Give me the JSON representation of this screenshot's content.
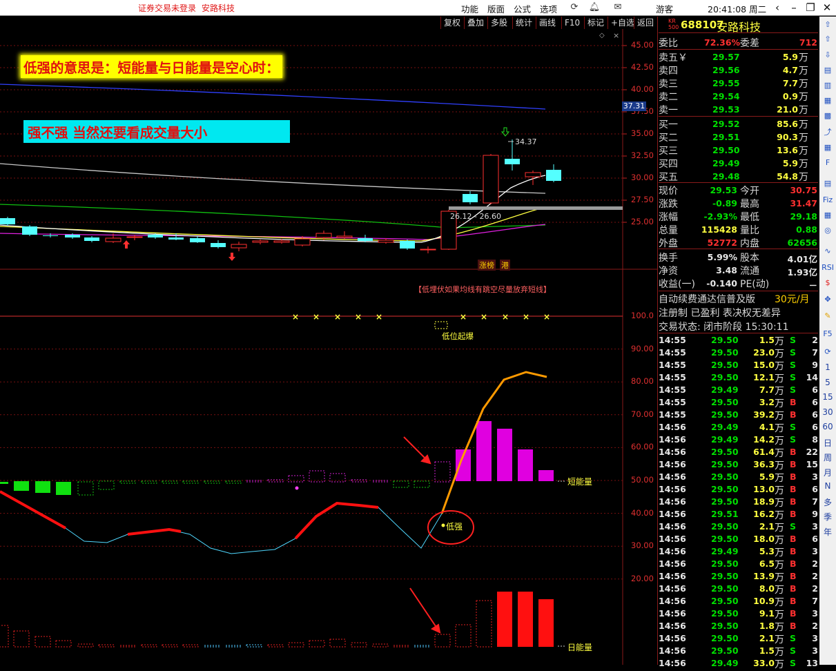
{
  "titlebar": {
    "login_status": "证券交易未登录",
    "stock_name": "安路科技",
    "menus": [
      "功能",
      "版面",
      "公式",
      "选项"
    ],
    "user": "游客",
    "clock": "20:41:08 周二"
  },
  "chart_toolbar": [
    "复权",
    "叠加",
    "多股",
    "统计",
    "画线",
    "F10",
    "标记",
    "+自选",
    "返回"
  ],
  "price_axis": [
    "45.00",
    "42.50",
    "40.00",
    "37.50",
    "35.00",
    "32.50",
    "30.00",
    "27.50",
    "25.00"
  ],
  "price_marker": "37.31",
  "indicator_axis": [
    "100.0",
    "90.00",
    "80.00",
    "70.00",
    "60.00",
    "50.00",
    "40.00",
    "30.00",
    "20.00"
  ],
  "annotations": {
    "banner1": "低强的意思是：短能量与日能量是空心时：",
    "banner2": "强不强   当然还要看成交量大小",
    "high_label": "34.37",
    "range_label": "26.12 - 26.60",
    "tag1": "涨榜",
    "tag2": "港",
    "notice": "【低埋伏如果均线有跳空尽量放弃短线】",
    "low_pos": "低位起爆",
    "low_strong": "低强",
    "short_energy": "短能量",
    "daily_energy": "日能量"
  },
  "quote": {
    "market_badge_top": "KR",
    "market_badge_bottom": "500",
    "code": "688107",
    "name": "安路科技",
    "weibi_label": "委比",
    "weibi": "72.36%",
    "weicha_label": "委差",
    "weicha": "712",
    "asks": [
      {
        "label": "卖五￥",
        "price": "29.57",
        "vol": "5.9",
        "unit": "万"
      },
      {
        "label": "卖四",
        "price": "29.56",
        "vol": "4.7",
        "unit": "万"
      },
      {
        "label": "卖三",
        "price": "29.55",
        "vol": "7.7",
        "unit": "万"
      },
      {
        "label": "卖二",
        "price": "29.54",
        "vol": "0.9",
        "unit": "万"
      },
      {
        "label": "卖一",
        "price": "29.53",
        "vol": "21.0",
        "unit": "万"
      }
    ],
    "bids": [
      {
        "label": "买一",
        "price": "29.52",
        "vol": "85.6",
        "unit": "万"
      },
      {
        "label": "买二",
        "price": "29.51",
        "vol": "90.3",
        "unit": "万"
      },
      {
        "label": "买三",
        "price": "29.50",
        "vol": "13.6",
        "unit": "万"
      },
      {
        "label": "买四",
        "price": "29.49",
        "vol": "5.9",
        "unit": "万"
      },
      {
        "label": "买五",
        "price": "29.48",
        "vol": "54.8",
        "unit": "万"
      }
    ],
    "stats": [
      {
        "l1": "现价",
        "v1": "29.53",
        "c1": "green",
        "l2": "今开",
        "v2": "30.75",
        "c2": "red"
      },
      {
        "l1": "涨跌",
        "v1": "-0.89",
        "c1": "green",
        "l2": "最高",
        "v2": "31.47",
        "c2": "red"
      },
      {
        "l1": "涨幅",
        "v1": "-2.93%",
        "c1": "green",
        "l2": "最低",
        "v2": "29.18",
        "c2": "green"
      },
      {
        "l1": "总量",
        "v1": "115428",
        "c1": "yellow",
        "l2": "量比",
        "v2": "0.88",
        "c2": "green"
      },
      {
        "l1": "外盘",
        "v1": "52772",
        "c1": "red",
        "l2": "内盘",
        "v2": "62656",
        "c2": "green"
      }
    ],
    "stats2": [
      {
        "l1": "换手",
        "v1": "5.99%",
        "l2": "股本",
        "v2": "4.01亿"
      },
      {
        "l1": "净资",
        "v1": "3.48",
        "l2": "流通",
        "v2": "1.93亿"
      },
      {
        "l1": "收益(一)",
        "v1": "-0.140",
        "l2": "PE(动)",
        "v2": "－"
      }
    ],
    "promo1": "自动续费通达信普及版",
    "promo_price": "30元/月",
    "promo2": "注册制 已盈利 表决权无差异",
    "trade_state": "交易状态: 闭市阶段 15:30:11",
    "ticks": [
      {
        "t": "14:55",
        "p": "29.50",
        "v": "1.5",
        "u": "万",
        "s": "S",
        "n": "2"
      },
      {
        "t": "14:55",
        "p": "29.50",
        "v": "23.0",
        "u": "万",
        "s": "S",
        "n": "7"
      },
      {
        "t": "14:55",
        "p": "29.50",
        "v": "15.0",
        "u": "万",
        "s": "S",
        "n": "9"
      },
      {
        "t": "14:55",
        "p": "29.50",
        "v": "12.1",
        "u": "万",
        "s": "S",
        "n": "14"
      },
      {
        "t": "14:55",
        "p": "29.49",
        "v": "7.7",
        "u": "万",
        "s": "S",
        "n": "6"
      },
      {
        "t": "14:55",
        "p": "29.50",
        "v": "3.2",
        "u": "万",
        "s": "B",
        "n": "6"
      },
      {
        "t": "14:55",
        "p": "29.50",
        "v": "39.2",
        "u": "万",
        "s": "B",
        "n": "6"
      },
      {
        "t": "14:56",
        "p": "29.49",
        "v": "4.1",
        "u": "万",
        "s": "S",
        "n": "6"
      },
      {
        "t": "14:56",
        "p": "29.49",
        "v": "14.2",
        "u": "万",
        "s": "S",
        "n": "8"
      },
      {
        "t": "14:56",
        "p": "29.50",
        "v": "61.4",
        "u": "万",
        "s": "B",
        "n": "22"
      },
      {
        "t": "14:56",
        "p": "29.50",
        "v": "36.3",
        "u": "万",
        "s": "B",
        "n": "15"
      },
      {
        "t": "14:56",
        "p": "29.50",
        "v": "5.9",
        "u": "万",
        "s": "B",
        "n": "3"
      },
      {
        "t": "14:56",
        "p": "29.50",
        "v": "13.0",
        "u": "万",
        "s": "B",
        "n": "6"
      },
      {
        "t": "14:56",
        "p": "29.50",
        "v": "18.9",
        "u": "万",
        "s": "B",
        "n": "7"
      },
      {
        "t": "14:56",
        "p": "29.51",
        "v": "16.2",
        "u": "万",
        "s": "B",
        "n": "9"
      },
      {
        "t": "14:56",
        "p": "29.50",
        "v": "2.1",
        "u": "万",
        "s": "S",
        "n": "3"
      },
      {
        "t": "14:56",
        "p": "29.50",
        "v": "18.0",
        "u": "万",
        "s": "B",
        "n": "6"
      },
      {
        "t": "14:56",
        "p": "29.49",
        "v": "5.3",
        "u": "万",
        "s": "B",
        "n": "3"
      },
      {
        "t": "14:56",
        "p": "29.50",
        "v": "6.5",
        "u": "万",
        "s": "B",
        "n": "2"
      },
      {
        "t": "14:56",
        "p": "29.50",
        "v": "13.9",
        "u": "万",
        "s": "B",
        "n": "2"
      },
      {
        "t": "14:56",
        "p": "29.50",
        "v": "8.0",
        "u": "万",
        "s": "B",
        "n": "2"
      },
      {
        "t": "14:56",
        "p": "29.50",
        "v": "10.9",
        "u": "万",
        "s": "B",
        "n": "7"
      },
      {
        "t": "14:56",
        "p": "29.50",
        "v": "9.1",
        "u": "万",
        "s": "B",
        "n": "3"
      },
      {
        "t": "14:56",
        "p": "29.50",
        "v": "1.8",
        "u": "万",
        "s": "B",
        "n": "2"
      },
      {
        "t": "14:56",
        "p": "29.50",
        "v": "2.1",
        "u": "万",
        "s": "S",
        "n": "3"
      },
      {
        "t": "14:56",
        "p": "29.50",
        "v": "1.5",
        "u": "万",
        "s": "S",
        "n": "3"
      },
      {
        "t": "14:56",
        "p": "29.49",
        "v": "33.0",
        "u": "万",
        "s": "S",
        "n": "13"
      }
    ]
  },
  "sidebar_periods": [
    "1",
    "5",
    "15",
    "30",
    "60",
    "日",
    "周",
    "月",
    "N",
    "多",
    "季",
    "年"
  ],
  "colors": {
    "up": "#ff3030",
    "down": "#00e000",
    "cyan": "#54ffff",
    "magenta": "#e000e0",
    "orange": "#ff9a00",
    "panel_border": "#8a1a1a"
  }
}
